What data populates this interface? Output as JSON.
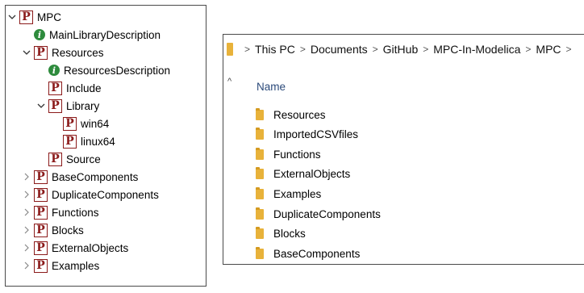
{
  "tree": {
    "items": [
      {
        "label": "MPC",
        "icon": "modelica-package-icon",
        "indent": 0,
        "chevron": "down"
      },
      {
        "label": "MainLibraryDescription",
        "icon": "info-icon",
        "indent": 1,
        "chevron": ""
      },
      {
        "label": "Resources",
        "icon": "modelica-package-icon",
        "indent": 1,
        "chevron": "down"
      },
      {
        "label": "ResourcesDescription",
        "icon": "info-icon",
        "indent": 2,
        "chevron": ""
      },
      {
        "label": "Include",
        "icon": "modelica-package-icon",
        "indent": 2,
        "chevron": ""
      },
      {
        "label": "Library",
        "icon": "modelica-package-icon",
        "indent": 2,
        "chevron": "down"
      },
      {
        "label": "win64",
        "icon": "modelica-package-icon",
        "indent": 3,
        "chevron": ""
      },
      {
        "label": "linux64",
        "icon": "modelica-package-icon",
        "indent": 3,
        "chevron": ""
      },
      {
        "label": "Source",
        "icon": "modelica-package-icon",
        "indent": 2,
        "chevron": ""
      },
      {
        "label": "BaseComponents",
        "icon": "modelica-package-icon",
        "indent": 1,
        "chevron": "right"
      },
      {
        "label": "DuplicateComponents",
        "icon": "modelica-package-icon",
        "indent": 1,
        "chevron": "right"
      },
      {
        "label": "Functions",
        "icon": "modelica-package-icon",
        "indent": 1,
        "chevron": "right"
      },
      {
        "label": "Blocks",
        "icon": "modelica-package-icon",
        "indent": 1,
        "chevron": "right"
      },
      {
        "label": "ExternalObjects",
        "icon": "modelica-package-icon",
        "indent": 1,
        "chevron": "right"
      },
      {
        "label": "Examples",
        "icon": "modelica-package-icon",
        "indent": 1,
        "chevron": "right"
      }
    ],
    "package_glyph": "P",
    "info_glyph": "i"
  },
  "explorer": {
    "breadcrumb": [
      "This PC",
      "Documents",
      "GitHub",
      "MPC-In-Modelica",
      "MPC"
    ],
    "separator": ">",
    "column_header": "Name",
    "folders": [
      "Resources",
      "ImportedCSVfiles",
      "Functions",
      "ExternalObjects",
      "Examples",
      "DuplicateComponents",
      "Blocks",
      "BaseComponents"
    ]
  },
  "colors": {
    "package": "#8b1a1a",
    "info": "#2e8b3d",
    "folder": "#e8b23a",
    "header_text": "#2b4a7a"
  }
}
